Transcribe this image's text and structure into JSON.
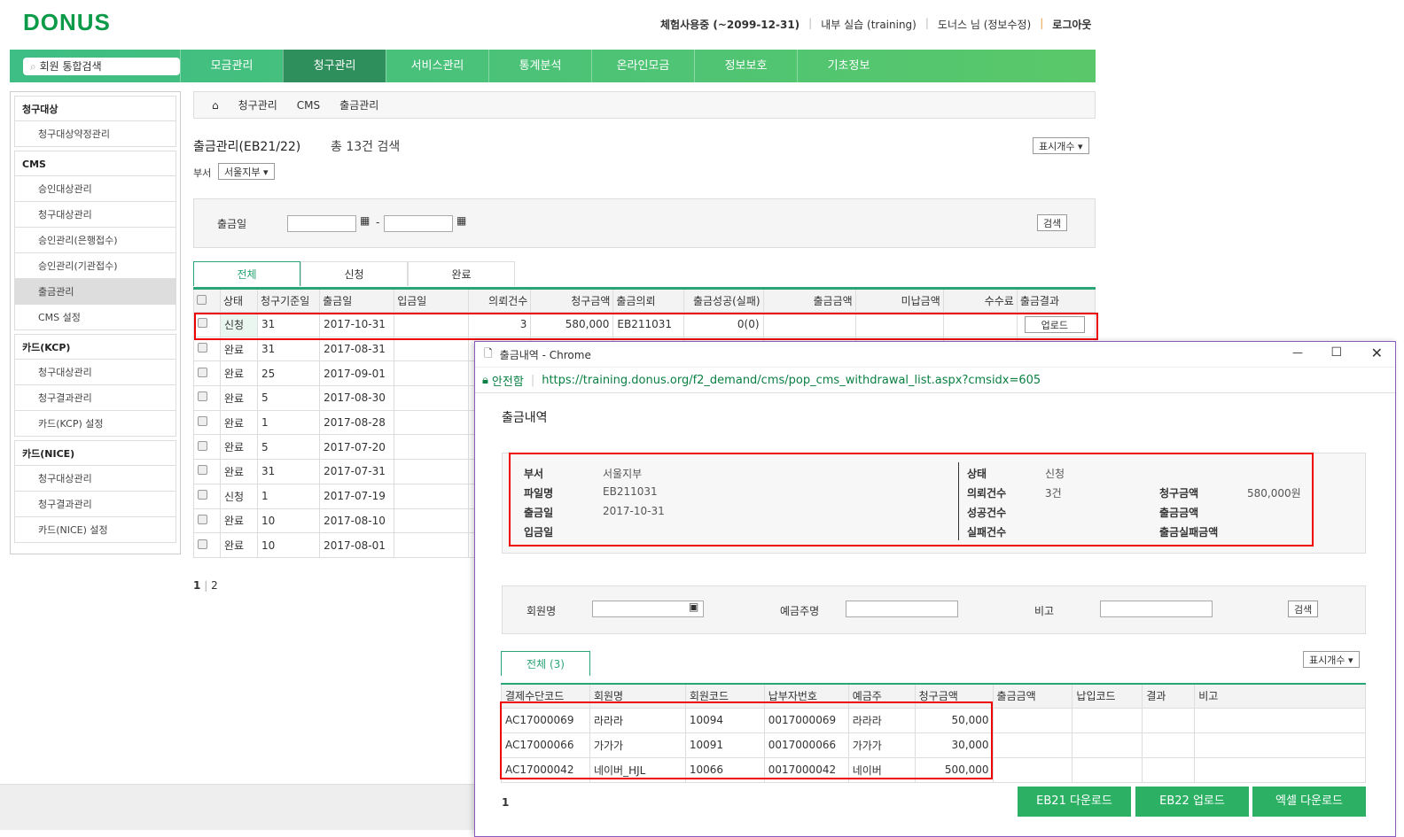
{
  "header": {
    "logo": "DONUS",
    "links": [
      "체험사용중 (~2099-12-31)",
      "내부 실습 (training)",
      "도너스 님 (정보수정)",
      "로그아웃"
    ]
  },
  "nav": {
    "search_placeholder": "회원 통합검색",
    "items": [
      "모금관리",
      "청구관리",
      "서비스관리",
      "통계분석",
      "온라인모금",
      "정보보호",
      "기초정보"
    ]
  },
  "sidebar": {
    "items": [
      {
        "label": "청구대상",
        "group": true
      },
      {
        "label": "청구대상약정관리"
      },
      {
        "label": "CMS",
        "group": true
      },
      {
        "label": "승인대상관리"
      },
      {
        "label": "청구대상관리"
      },
      {
        "label": "승인관리(은행접수)"
      },
      {
        "label": "승인관리(기관접수)"
      },
      {
        "label": "출금관리",
        "selected": true
      },
      {
        "label": "CMS 설정"
      },
      {
        "label": "카드(KCP)",
        "group": true
      },
      {
        "label": "청구대상관리"
      },
      {
        "label": "청구결과관리"
      },
      {
        "label": "카드(KCP) 설정"
      },
      {
        "label": "카드(NICE)",
        "group": true
      },
      {
        "label": "청구대상관리"
      },
      {
        "label": "청구결과관리"
      },
      {
        "label": "카드(NICE) 설정"
      }
    ]
  },
  "breadcrumb": [
    "청구관리",
    "CMS",
    "출금관리"
  ],
  "page": {
    "title": "출금관리(EB21/22)",
    "count": "총 13건 검색",
    "display_count": "표시개수 ▾",
    "dept_label": "부서",
    "dept_value": "서울지부 ▾",
    "date_label": "출금일",
    "date_sep": "-",
    "search": "검색"
  },
  "tabs": [
    "전체",
    "신청",
    "완료"
  ],
  "table": {
    "headers": [
      "상태",
      "청구기준일",
      "출금일",
      "입금일",
      "의뢰건수",
      "청구금액",
      "출금의뢰",
      "출금성공(실패)",
      "출금금액",
      "미납금액",
      "수수료",
      "출금결과"
    ],
    "rows": [
      [
        "신청",
        "31",
        "2017-10-31",
        "",
        "3",
        "580,000",
        "EB211031",
        "0(0)",
        "",
        "",
        "",
        "업로드"
      ],
      [
        "완료",
        "31",
        "2017-08-31"
      ],
      [
        "완료",
        "25",
        "2017-09-01"
      ],
      [
        "완료",
        "5",
        "2017-08-30"
      ],
      [
        "완료",
        "1",
        "2017-08-28"
      ],
      [
        "완료",
        "5",
        "2017-07-20"
      ],
      [
        "완료",
        "31",
        "2017-07-31"
      ],
      [
        "신청",
        "1",
        "2017-07-19"
      ],
      [
        "완료",
        "10",
        "2017-08-10"
      ],
      [
        "완료",
        "10",
        "2017-08-01"
      ]
    ]
  },
  "pagination": [
    "1",
    "|",
    "2"
  ],
  "popup": {
    "window_title": "출금내역 - Chrome",
    "secure": "안전함",
    "url": "https://training.donus.org/f2_demand/cms/pop_cms_withdrawal_list.aspx?cmsidx=605",
    "heading": "출금내역",
    "info": {
      "부서": "서울지부",
      "파일명": "EB211031",
      "출금일": "2017-10-31",
      "입금일": "",
      "상태": "신청",
      "의뢰건수": "3건",
      "성공건수": "",
      "실패건수": "",
      "청구금액": "580,000원",
      "출금금액": "",
      "출금실패금액": ""
    },
    "info_labels": [
      "부서",
      "파일명",
      "출금일",
      "입금일",
      "상태",
      "의뢰건수",
      "성공건수",
      "실패건수",
      "청구금액",
      "출금금액",
      "출금실패금액"
    ],
    "filter": {
      "member": "회원명",
      "holder": "예금주명",
      "note": "비고",
      "search": "검색"
    },
    "tab": "전체 (3)",
    "display_count": "표시개수 ▾",
    "headers": [
      "결제수단코드",
      "회원명",
      "회원코드",
      "납부자번호",
      "예금주",
      "청구금액",
      "출금금액",
      "납입코드",
      "결과",
      "비고"
    ],
    "rows": [
      [
        "AC17000069",
        "라라라",
        "10094",
        "0017000069",
        "라라라",
        "50,000",
        "",
        "",
        "",
        ""
      ],
      [
        "AC17000066",
        "가가가",
        "10091",
        "0017000066",
        "가가가",
        "30,000",
        "",
        "",
        "",
        ""
      ],
      [
        "AC17000042",
        "네이버_HJL",
        "10066",
        "0017000042",
        "네이버",
        "500,000",
        "",
        "",
        "",
        ""
      ]
    ],
    "page": "1",
    "buttons": [
      "EB21 다운로드",
      "EB22 업로드",
      "엑셀 다운로드"
    ]
  },
  "colors": {
    "brand": "#0a9a48",
    "accent": "#2aa676",
    "highlight": "#e00000"
  }
}
